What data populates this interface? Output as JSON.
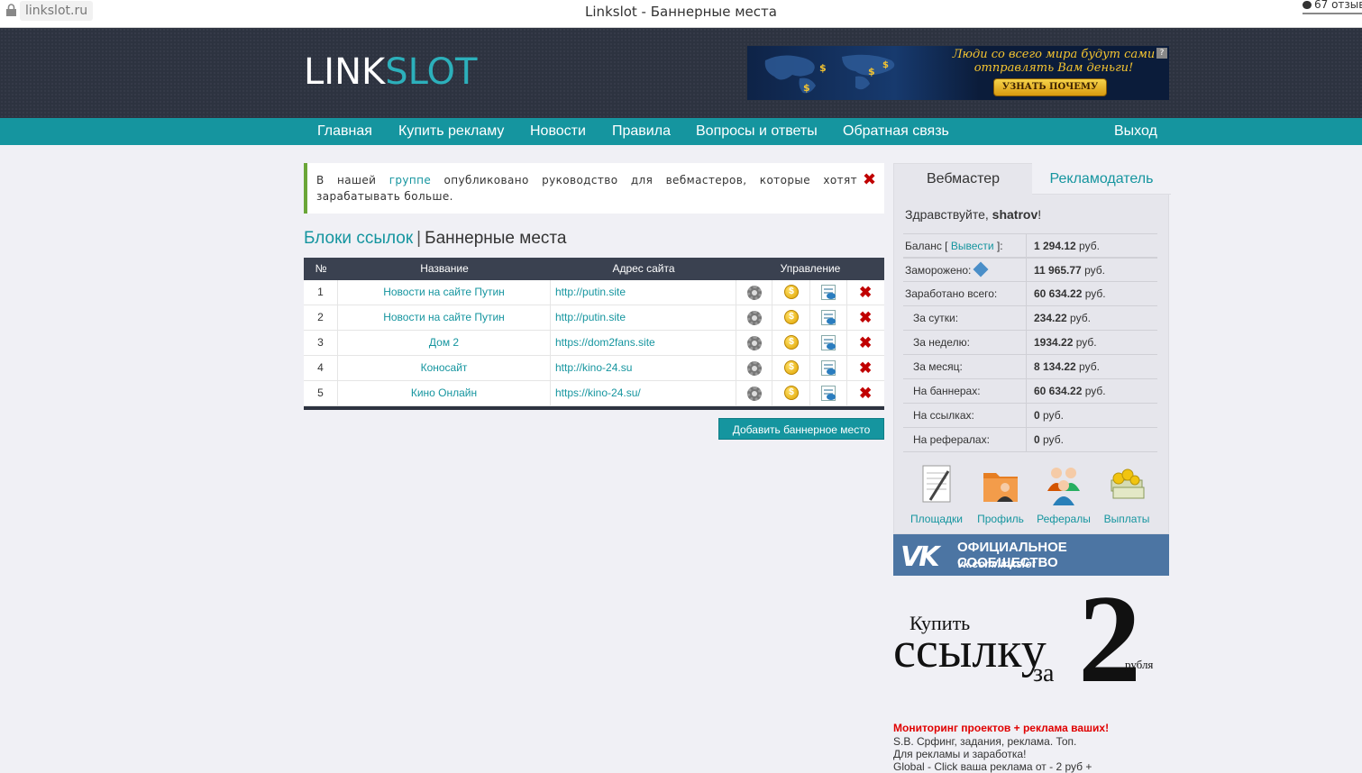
{
  "browser": {
    "url": "linkslot.ru",
    "title": "Linkslot - Баннерные места",
    "reviews": "67 отзыв"
  },
  "header": {
    "logo_link": "LINK",
    "logo_slot": "SLOT",
    "banner": {
      "text": "Люди со всего мира будут сами отправлять Вам деньги!",
      "button": "УЗНАТЬ ПОЧЕМУ",
      "help": "?"
    }
  },
  "nav": {
    "items": [
      "Главная",
      "Купить рекламу",
      "Новости",
      "Правила",
      "Вопросы и ответы",
      "Обратная связь"
    ],
    "logout": "Выход"
  },
  "notice": {
    "before": "В нашей ",
    "link": "группе",
    "after": " опубликовано руководство для вебмастеров, которые хотят зарабатывать больше.",
    "close": "✖"
  },
  "heading": {
    "link": "Блоки ссылок",
    "separator": "|",
    "current": "Баннерные места"
  },
  "table": {
    "columns": [
      "№",
      "Название",
      "Адрес сайта",
      "Управление"
    ],
    "rows": [
      {
        "num": "1",
        "name": "Новости на сайте Путин",
        "url": "http://putin.site"
      },
      {
        "num": "2",
        "name": "Новости на сайте Путин",
        "url": "http://putin.site"
      },
      {
        "num": "3",
        "name": "Дом 2",
        "url": "https://dom2fans.site"
      },
      {
        "num": "4",
        "name": "Коносайт",
        "url": "http://kino-24.su"
      },
      {
        "num": "5",
        "name": "Кино Онлайн",
        "url": "https://kino-24.su/"
      }
    ],
    "icons": {
      "settings": "gear-icon",
      "earnings": "coin-icon",
      "code": "code-icon",
      "delete": "delete-icon"
    },
    "add_button": "Добавить баннерное место"
  },
  "sidebar": {
    "tabs": {
      "webmaster": "Вебмастер",
      "advertiser": "Рекламодатель"
    },
    "greeting_prefix": "Здравствуйте, ",
    "username": "shatrov",
    "greeting_suffix": "!",
    "balance_label": "Баланс [",
    "withdraw_link": "Вывести",
    "balance_label_end": "]:",
    "stats": [
      {
        "label": "Заморожено:",
        "value": "11 965.77",
        "unit": " руб."
      },
      {
        "label": "Заработано всего:",
        "value": "60 634.22",
        "unit": " руб."
      },
      {
        "label": "За сутки:",
        "value": "234.22",
        "unit": " руб."
      },
      {
        "label": "За неделю:",
        "value": "1934.22",
        "unit": " руб."
      },
      {
        "label": "За месяц:",
        "value": "8 134.22",
        "unit": " руб."
      },
      {
        "label": "На баннерах:",
        "value": "60 634.22",
        "unit": " руб."
      },
      {
        "label": "На ссылках:",
        "value": "0",
        "unit": " руб."
      },
      {
        "label": "На рефералах:",
        "value": "0",
        "unit": " руб."
      }
    ],
    "balance_value": "1 294.12",
    "balance_unit": " руб.",
    "shortcuts": [
      "Площадки",
      "Профиль",
      "Рефералы",
      "Выплаты"
    ]
  },
  "vk": {
    "logo": "VK",
    "title": "ОФИЦИАЛЬНОЕ СООБЩЕСТВО",
    "url": "vk.com/linkslot"
  },
  "promo": {
    "buy": "Купить",
    "link": "ссылку",
    "za": "за",
    "two": "2",
    "rub": "рубля"
  },
  "ad": {
    "title": "Мониторинг проектов + реклама ваших!",
    "lines": [
      "S.B. Срфинг, задания, реклама. Топ.",
      "Для рекламы и заработка!",
      "Global - Click ваша реклама от - 2 руб +"
    ]
  },
  "colors": {
    "accent": "#15959f",
    "header": "#2d3340",
    "danger": "#c00000",
    "vk": "#4c75a3"
  }
}
